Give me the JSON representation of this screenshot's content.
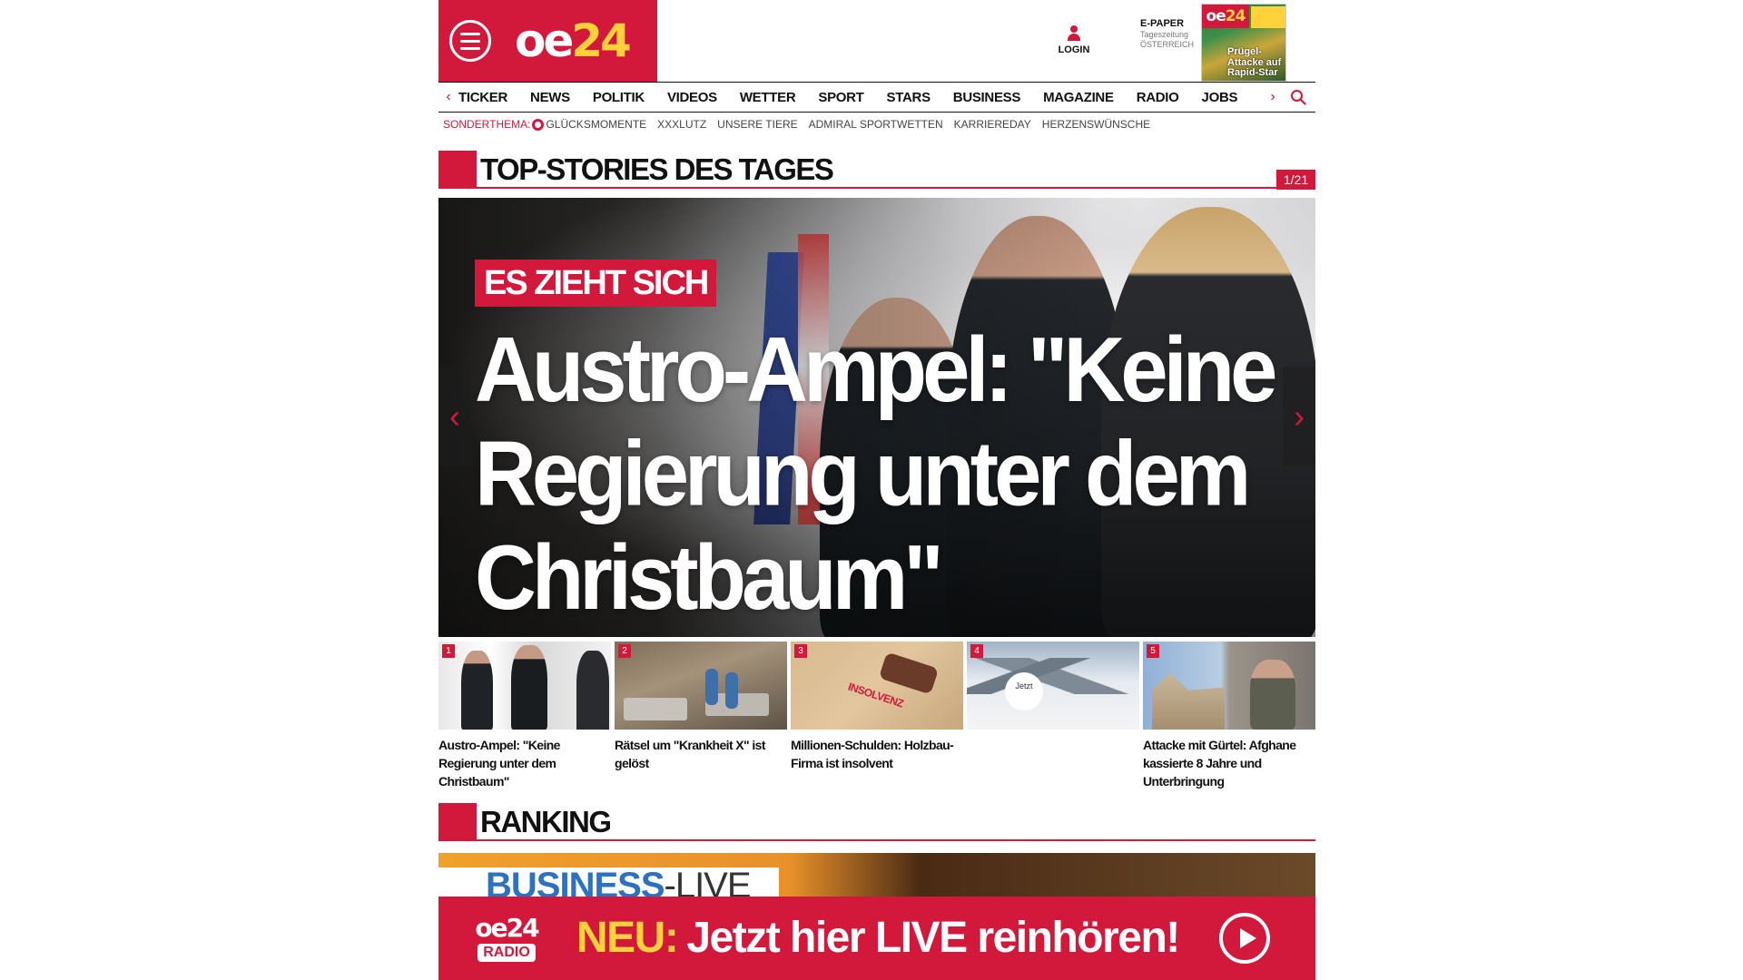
{
  "header": {
    "logo_main": "oe",
    "logo_num": "24",
    "login_label": "LOGIN",
    "epaper_title": "E-PAPER",
    "epaper_sub1": "Tageszeitung",
    "epaper_sub2": "ÖSTERREICH",
    "epaper_headline": "Prügel-Attacke auf Rapid-Star"
  },
  "nav": {
    "items": [
      "TICKER",
      "NEWS",
      "POLITIK",
      "VIDEOS",
      "WETTER",
      "SPORT",
      "STARS",
      "BUSINESS",
      "MAGAZINE",
      "RADIO",
      "JOBS"
    ],
    "left_arrow": "‹",
    "right_arrow": "›"
  },
  "subnav": {
    "label": "SONDERTHEMA:",
    "items": [
      "Glücksmomente",
      "XXXLutz",
      "Unsere Tiere",
      "Admiral Sportwetten",
      "Karriereday",
      "Herzenswünsche"
    ]
  },
  "top_stories": {
    "heading": "TOP-STORIES DES TAGES",
    "counter": "1/21",
    "hero": {
      "kicker": "ES ZIEHT SICH",
      "headline": "Austro-Ampel: \"Keine Regierung unter dem Christbaum\""
    },
    "thumbs": [
      {
        "num": "1",
        "caption": "Austro-Ampel: \"Keine Regierung unter dem Christbaum\""
      },
      {
        "num": "2",
        "caption": "Rätsel um \"Krankheit X\" ist gelöst"
      },
      {
        "num": "3",
        "caption": "Millionen-Schulden: Holzbau-Firma ist insolvent"
      },
      {
        "num": "4",
        "caption": ""
      },
      {
        "num": "5",
        "caption": "Attacke mit Gürtel: Afghane kassierte 8 Jahre und Unterbringung"
      }
    ]
  },
  "ranking": {
    "heading": "RANKING",
    "promo_business": "BUSINESS",
    "promo_live": "-LIVE"
  },
  "radio_banner": {
    "logo_top": "oe24",
    "logo_bottom": "RADIO",
    "neu": "NEU:",
    "text": "Jetzt hier LIVE reinhören!"
  },
  "colors": {
    "brand_red": "#d2183b",
    "brand_yellow": "#ffd23c"
  }
}
